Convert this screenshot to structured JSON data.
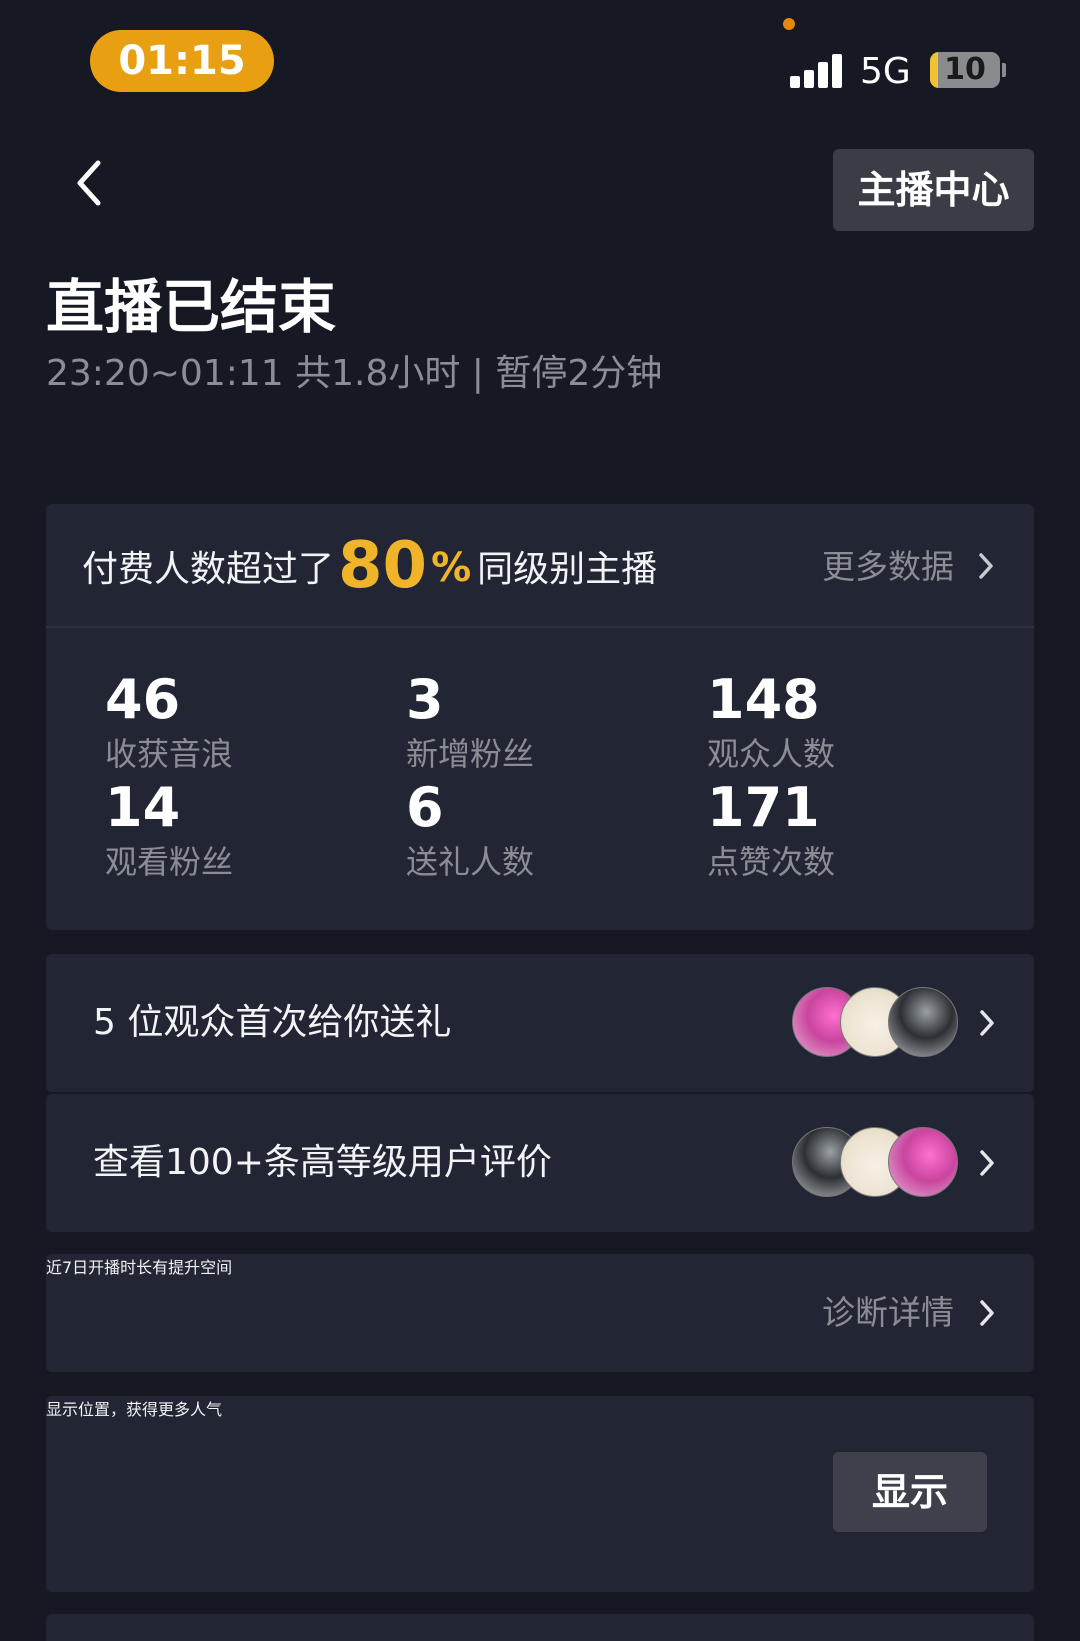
{
  "status_bar": {
    "time": "01:15",
    "network": "5G",
    "battery": "10"
  },
  "header": {
    "back_icon": "chevron-left-icon",
    "center_button": "主播中心"
  },
  "summary": {
    "title": "直播已结束",
    "subtitle": "23:20~01:11 共1.8小时 | 暂停2分钟"
  },
  "stats_card": {
    "pay_prefix": "付费人数超过了",
    "pay_percent": "80",
    "pay_percent_sign": "%",
    "pay_suffix": "同级别主播",
    "more_link": "更多数据",
    "stats": [
      {
        "value": "46",
        "label": "收获音浪"
      },
      {
        "value": "3",
        "label": "新增粉丝"
      },
      {
        "value": "148",
        "label": "观众人数"
      },
      {
        "value": "14",
        "label": "观看粉丝"
      },
      {
        "value": "6",
        "label": "送礼人数"
      },
      {
        "value": "171",
        "label": "点赞次数"
      }
    ]
  },
  "gift_row": {
    "label": "5 位观众首次给你送礼"
  },
  "review_row": {
    "label": "查看100+条高等级用户评价"
  },
  "diagnosis_row": {
    "label": "近7日开播时长有提升空间",
    "link": "诊断详情"
  },
  "location_row": {
    "label": "显示位置，获得更多人气",
    "button": "显示"
  },
  "colors": {
    "background": "#161824",
    "card": "#222533",
    "accent": "#f0b429",
    "time_pill": "#e8a012",
    "muted_text": "#8b8d96"
  }
}
